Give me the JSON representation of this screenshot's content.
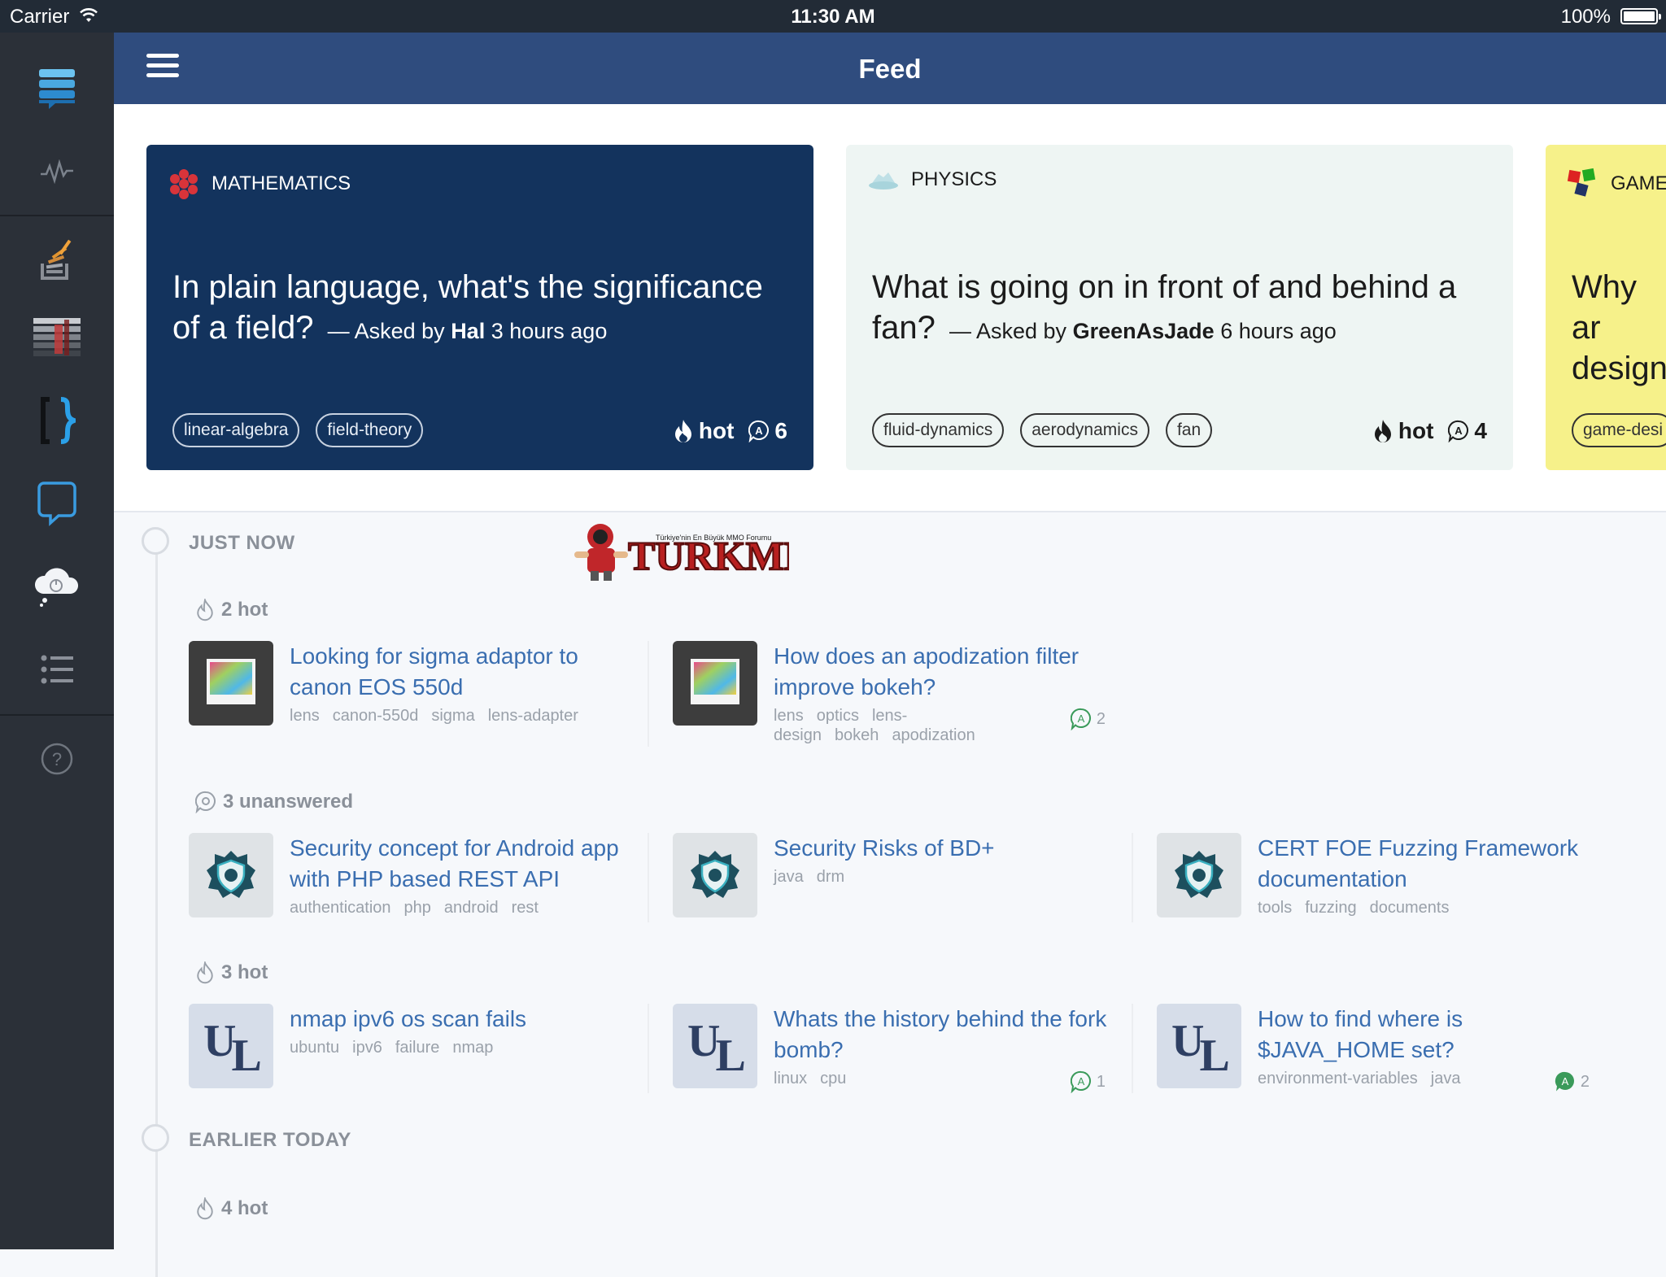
{
  "status_bar": {
    "carrier": "Carrier",
    "time": "11:30 AM",
    "battery": "100%"
  },
  "topbar": {
    "title": "Feed"
  },
  "sidebar": {
    "icons": [
      "feed-icon",
      "activity-icon",
      "stackoverflow-icon",
      "sites-list-icon",
      "code-brackets-icon",
      "chat-icon",
      "cloud-icon",
      "list-icon",
      "help-icon"
    ]
  },
  "cards": [
    {
      "site": "MATHEMATICS",
      "title": "In plain language, what's the significance of a field?",
      "asked_prefix": "— Asked by",
      "user": "Hal",
      "when": "3 hours ago",
      "tags": [
        "linear-algebra",
        "field-theory"
      ],
      "hot": "hot",
      "answers": "6",
      "bg": "#13335d"
    },
    {
      "site": "PHYSICS",
      "title": "What is going on in front of and behind a fan?",
      "asked_prefix": "— Asked by",
      "user": "GreenAsJade",
      "when": "6 hours ago",
      "tags": [
        "fluid-dynamics",
        "aerodynamics",
        "fan"
      ],
      "hot": "hot",
      "answers": "4",
      "bg": "#eef5f3"
    },
    {
      "site": "GAME",
      "title": "Why ar design",
      "tags": [
        "game-desi"
      ],
      "bg": "#f6f18a"
    }
  ],
  "banner": {
    "text": "TURKMMO",
    "sub": "Türkiye'nin En Büyük MMO Forumu"
  },
  "timeline": {
    "sections": [
      "JUST NOW",
      "EARLIER TODAY"
    ],
    "groups": [
      {
        "label": "2 hot",
        "items": [
          {
            "title": "Looking for sigma adaptor to canon EOS 550d",
            "tags": [
              "lens",
              "canon-550d",
              "sigma",
              "lens-adapter"
            ]
          },
          {
            "title": "How does an apodization filter improve bokeh?",
            "tags": [
              "lens",
              "optics",
              "lens-design",
              "bokeh",
              "apodization"
            ],
            "answers": "2"
          }
        ]
      },
      {
        "label": "3 unanswered",
        "items": [
          {
            "title": "Security concept for Android app with PHP based REST API",
            "tags": [
              "authentication",
              "php",
              "android",
              "rest"
            ]
          },
          {
            "title": "Security Risks of BD+",
            "tags": [
              "java",
              "drm"
            ]
          },
          {
            "title": "CERT FOE Fuzzing Framework documentation",
            "tags": [
              "tools",
              "fuzzing",
              "documents"
            ]
          }
        ]
      },
      {
        "label": "3 hot",
        "items": [
          {
            "title": "nmap ipv6 os scan fails",
            "tags": [
              "ubuntu",
              "ipv6",
              "failure",
              "nmap"
            ]
          },
          {
            "title": "Whats the history behind the fork bomb?",
            "tags": [
              "linux",
              "cpu"
            ],
            "answers": "1"
          },
          {
            "title": "How to find where is $JAVA_HOME set?",
            "tags": [
              "environment-variables",
              "java"
            ],
            "answers": "2"
          }
        ]
      },
      {
        "label": "4 hot"
      }
    ]
  },
  "colors": {
    "accent": "#3a6eb0",
    "topbar": "#2f4c7e",
    "sidebar": "#2b3038",
    "answer_green": "#3a9a5a"
  }
}
